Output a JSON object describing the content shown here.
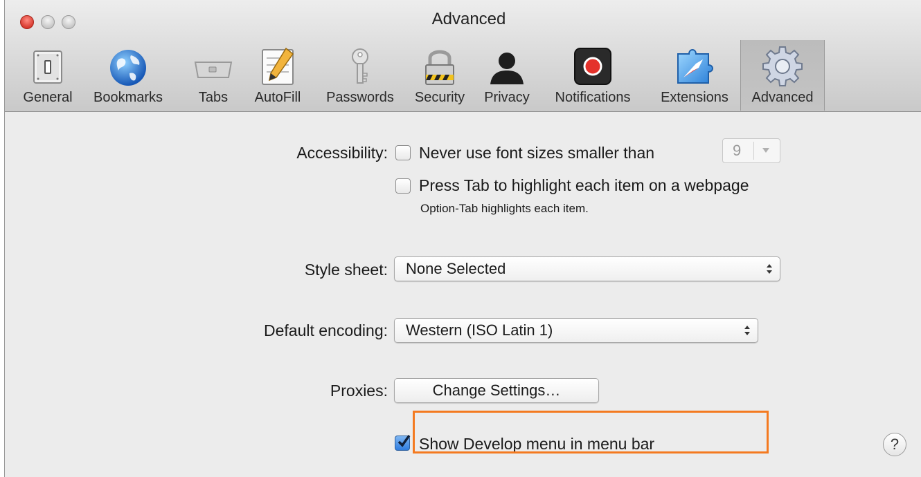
{
  "window": {
    "title": "Advanced"
  },
  "toolbar": {
    "items": [
      {
        "label": "General",
        "icon": "general-switch-icon"
      },
      {
        "label": "Bookmarks",
        "icon": "globe-icon"
      },
      {
        "label": "Tabs",
        "icon": "tabs-icon"
      },
      {
        "label": "AutoFill",
        "icon": "autofill-pencil-icon"
      },
      {
        "label": "Passwords",
        "icon": "key-icon"
      },
      {
        "label": "Security",
        "icon": "padlock-icon"
      },
      {
        "label": "Privacy",
        "icon": "person-silhouette-icon"
      },
      {
        "label": "Notifications",
        "icon": "record-icon"
      },
      {
        "label": "Extensions",
        "icon": "extensions-compass-icon"
      },
      {
        "label": "Advanced",
        "icon": "gear-icon",
        "selected": true
      }
    ]
  },
  "accessibility": {
    "label": "Accessibility:",
    "min_font_option": "Never use font sizes smaller than",
    "min_font_value": "9",
    "tab_option": "Press Tab to highlight each item on a webpage",
    "tab_hint": "Option-Tab highlights each item."
  },
  "stylesheet": {
    "label": "Style sheet:",
    "value": "None Selected"
  },
  "encoding": {
    "label": "Default encoding:",
    "value": "Western (ISO Latin 1)"
  },
  "proxies": {
    "label": "Proxies:",
    "button": "Change Settings…"
  },
  "develop": {
    "label": "Show Develop menu in menu bar",
    "checked": true
  },
  "help": {
    "label": "?"
  },
  "colors": {
    "highlight": "#f47a20",
    "checkbox_checked": "#2f7de0"
  }
}
